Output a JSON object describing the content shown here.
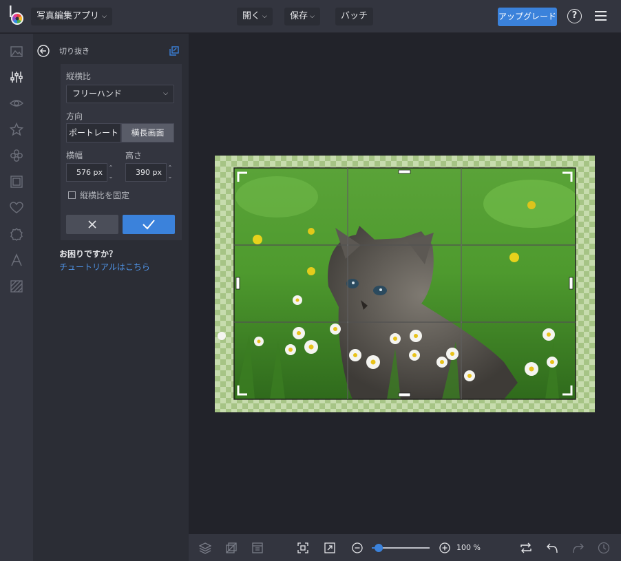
{
  "topbar": {
    "app_name": "写真編集アプリ",
    "menus": [
      "開く",
      "保存",
      "バッチ"
    ],
    "upgrade_label": "アップグレード",
    "help_glyph": "?"
  },
  "rail": {
    "icons": [
      "image-icon",
      "sliders-icon",
      "eye-icon",
      "star-icon",
      "flower-icon",
      "frame-icon",
      "heart-icon",
      "badge-icon",
      "text-icon",
      "texture-icon"
    ]
  },
  "panel": {
    "title": "切り抜き",
    "aspect_label": "縦横比",
    "aspect_value": "フリーハンド",
    "orientation_label": "方向",
    "orientation_options": [
      "ポートレート",
      "横長画面"
    ],
    "orientation_selected": "横長画面",
    "width_label": "横幅",
    "height_label": "高さ",
    "width_value": "576 px",
    "height_value": "390 px",
    "lock_label": "縦横比を固定",
    "lock_checked": false
  },
  "help": {
    "question": "お困りですか？",
    "link": "チュートリアルはこちら"
  },
  "bottombar": {
    "zoom_level": 0.12,
    "zoom_label": "100 %"
  },
  "colors": {
    "accent": "#3b82db",
    "panel": "#2b2d35",
    "bar": "#33353f",
    "canvas": "#22232a"
  }
}
